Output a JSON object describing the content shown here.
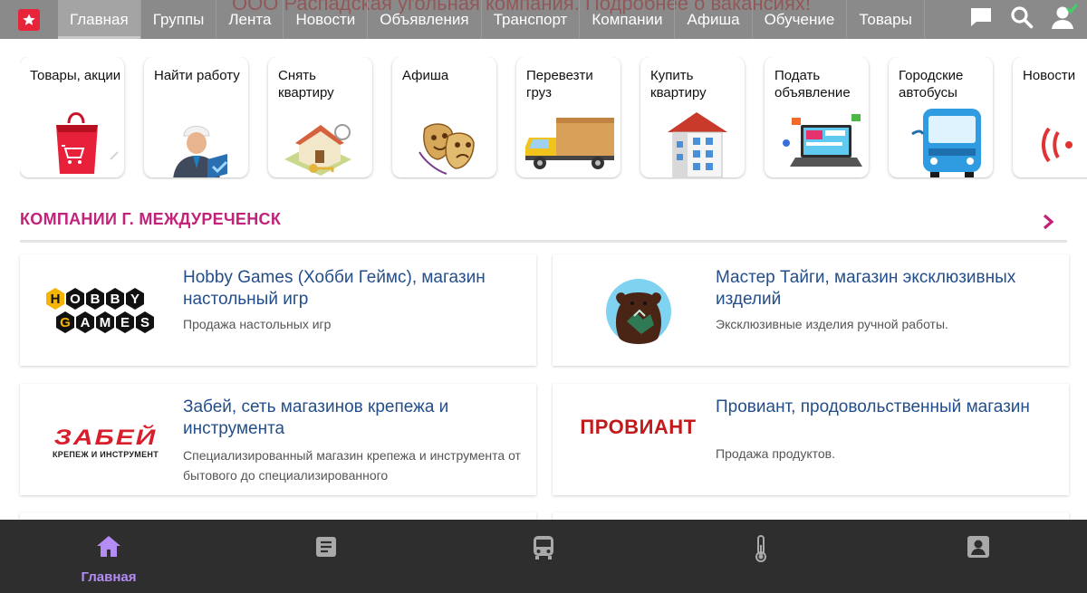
{
  "topnav": {
    "marquee": "ООО Распадская угольная компания. Подробнее о вакансиях!",
    "items": [
      "Главная",
      "Группы",
      "Лента",
      "Новости",
      "Объявления",
      "Транспорт",
      "Компании",
      "Афиша",
      "Обучение",
      "Товары"
    ],
    "active_index": 0,
    "icons": [
      "chat-icon",
      "search-icon",
      "user-icon"
    ]
  },
  "tiles": [
    {
      "label": "Товары, акции",
      "icon": "shopping-bag-icon"
    },
    {
      "label": "Найти работу",
      "icon": "worker-icon"
    },
    {
      "label": "Снять квартиру",
      "icon": "house-key-icon"
    },
    {
      "label": "Афиша",
      "icon": "theatre-masks-icon"
    },
    {
      "label": "Перевезти груз",
      "icon": "truck-icon"
    },
    {
      "label": "Купить квартиру",
      "icon": "apartment-building-icon"
    },
    {
      "label": "Подать объявление",
      "icon": "laptop-ads-icon"
    },
    {
      "label": "Городские автобусы",
      "icon": "bus-icon"
    },
    {
      "label": "Новости",
      "icon": "news-icon"
    }
  ],
  "section": {
    "title": "КОМПАНИИ Г. МЕЖДУРЕЧЕНСК"
  },
  "companies": [
    {
      "title": "Hobby Games (Хобби Геймс), магазин настольный игр",
      "desc": "Продажа настольных игр",
      "logo": "hobby-games-logo"
    },
    {
      "title": "Мастер Тайги, магазин эксклюзивных изделий",
      "desc": "Эксклюзивные изделия ручной работы.",
      "logo": "bear-logo"
    },
    {
      "title": "Забей, сеть магазинов крепежа и инструмента",
      "desc": "Специализированный магазин крепежа и инструмента от бытового до специализированного",
      "logo": "zabei-logo",
      "logo_text": "ЗАБЕЙ",
      "logo_sub": "КРЕПЕЖ И ИНСТРУМЕНТ"
    },
    {
      "title": "Провиант, продовольственный магазин",
      "desc": "Продажа продуктов.",
      "logo": "proviant-logo",
      "logo_text": "ПРОВИАНТ"
    }
  ],
  "tabbar": {
    "items": [
      {
        "label": "Главная",
        "icon": "home-icon",
        "active": true
      },
      {
        "label": "",
        "icon": "article-icon",
        "active": false
      },
      {
        "label": "",
        "icon": "bus-icon",
        "active": false
      },
      {
        "label": "",
        "icon": "thermometer-icon",
        "active": false
      },
      {
        "label": "",
        "icon": "account-box-icon",
        "active": false
      }
    ]
  },
  "colors": {
    "nav_bg": "#8a8a8a",
    "accent_magenta": "#c1227a",
    "link_blue": "#234e8a",
    "tabbar_bg": "#2e2e2e",
    "tab_active": "#b48cf4"
  }
}
